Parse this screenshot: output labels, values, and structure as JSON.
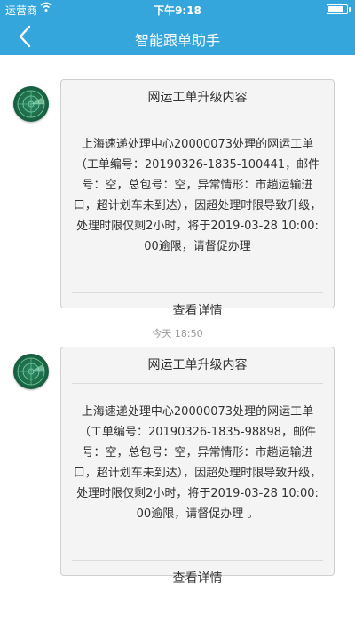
{
  "status": {
    "carrier": "运营商",
    "time": "下午9:18",
    "battery_level": 0.95
  },
  "nav": {
    "title": "智能跟单助手"
  },
  "messages": [
    {
      "header": "网运工单升级内容",
      "body": "上海速递处理中心20000073处理的网运工单（工单编号：20190326-1835-100441，邮件号：空，总包号：空，异常情形：市趟运输进口，超计划车未到达），因超处理时限导致升级，处理时限仅剩2小时，将于2019-03-28 10:00:00逾限，请督促办理",
      "action": "查看详情"
    },
    {
      "header": "网运工单升级内容",
      "body": "上海速递处理中心20000073处理的网运工单（工单编号：20190326-1835-98898，邮件号：空，总包号：空，异常情形：市趟运输进口，超计划车未到达），因超处理时限导致升级，处理时限仅剩2小时，将于2019-03-28 10:00:00逾限，请督促办理 。",
      "action": "查看详情"
    }
  ],
  "timestamp": "今天 18:50"
}
